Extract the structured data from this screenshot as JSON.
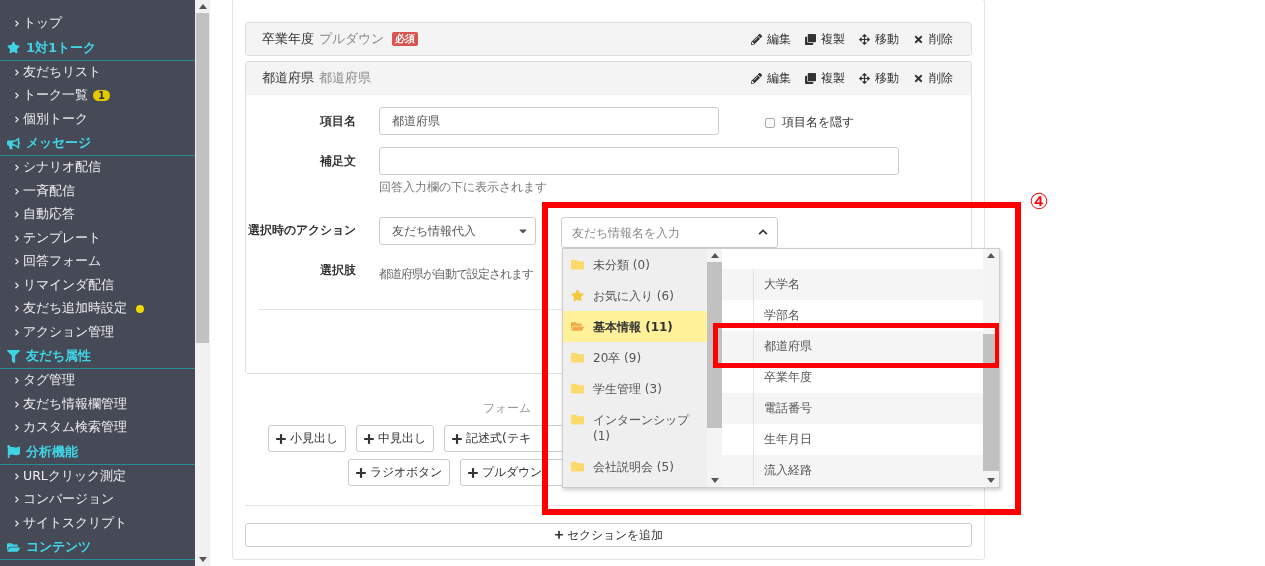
{
  "sidebar": {
    "items": [
      {
        "kind": "link",
        "label": "トップ",
        "dot": false
      },
      {
        "kind": "heading",
        "label": "1対1トーク"
      },
      {
        "kind": "link",
        "label": "友だちリスト",
        "dot": false
      },
      {
        "kind": "link",
        "label": "トーク一覧",
        "badge": "1",
        "dot": false
      },
      {
        "kind": "link",
        "label": "個別トーク",
        "dot": false
      },
      {
        "kind": "heading",
        "label": "メッセージ"
      },
      {
        "kind": "link",
        "label": "シナリオ配信",
        "dot": false
      },
      {
        "kind": "link",
        "label": "一斉配信",
        "dot": false
      },
      {
        "kind": "link",
        "label": "自動応答",
        "dot": false
      },
      {
        "kind": "link",
        "label": "テンプレート",
        "dot": false
      },
      {
        "kind": "link",
        "label": "回答フォーム",
        "dot": false
      },
      {
        "kind": "link",
        "label": "リマインダ配信",
        "dot": false
      },
      {
        "kind": "link",
        "label": "友だち追加時設定",
        "dot": true
      },
      {
        "kind": "link",
        "label": "アクション管理",
        "dot": false
      },
      {
        "kind": "heading",
        "label": "友だち属性"
      },
      {
        "kind": "link",
        "label": "タグ管理",
        "dot": false
      },
      {
        "kind": "link",
        "label": "友だち情報欄管理",
        "dot": false
      },
      {
        "kind": "link",
        "label": "カスタム検索管理",
        "dot": false
      },
      {
        "kind": "heading",
        "label": "分析機能"
      },
      {
        "kind": "link",
        "label": "URLクリック測定",
        "dot": false
      },
      {
        "kind": "link",
        "label": "コンバージョン",
        "dot": false
      },
      {
        "kind": "link",
        "label": "サイトスクリプト",
        "dot": false
      },
      {
        "kind": "heading",
        "label": "コンテンツ"
      }
    ]
  },
  "fields": [
    {
      "title": "卒業年度",
      "type": "プルダウン",
      "badge": "必須",
      "expanded": false,
      "actions": [
        "編集",
        "複製",
        "移動",
        "削除"
      ]
    },
    {
      "title": "都道府県",
      "type": "都道府県",
      "expanded": true,
      "actions": [
        "編集",
        "複製",
        "移動",
        "削除"
      ]
    }
  ],
  "editor": {
    "item_name": {
      "label": "項目名",
      "value": "都道府県"
    },
    "hide_name": {
      "label": "項目名を隠す",
      "checked": false
    },
    "note": {
      "label": "補足文",
      "hint": "回答入力欄の下に表示されます"
    },
    "action": {
      "label": "選択時のアクション",
      "select_value": "友だち情報代入",
      "search": {
        "placeholder": "友だち情報名を入力",
        "expanded": true
      }
    },
    "choices": {
      "label": "選択肢",
      "text": "都道府県が自動で設定されます"
    }
  },
  "dropdown": {
    "categories": [
      {
        "kind": "folder",
        "label": "未分類 (0)",
        "selected": false
      },
      {
        "kind": "favorite",
        "label": "お気に入り (6)",
        "selected": false
      },
      {
        "kind": "folder",
        "label": "基本情報 (11)",
        "selected": true
      },
      {
        "kind": "folder",
        "label": "20卒 (9)",
        "selected": false
      },
      {
        "kind": "folder",
        "label": "学生管理 (3)",
        "selected": false
      },
      {
        "kind": "folder",
        "label": "インターンシップ (1)",
        "selected": false
      },
      {
        "kind": "folder",
        "label": "会社説明会 (5)",
        "selected": false
      }
    ],
    "fields": [
      "大学名",
      "学部名",
      "都道府県",
      "卒業年度",
      "電話番号",
      "生年月日",
      "流入経路"
    ]
  },
  "add_fields": {
    "caption": "フォーム",
    "rows": [
      {
        "buttons": [
          "小見出し",
          "中見出し",
          "記述式(テキ"
        ]
      },
      {
        "buttons": [
          "ラジオボタン",
          "プルダウン"
        ]
      }
    ]
  },
  "add_section": "セクションを追加",
  "annotation": {
    "marker": "④"
  }
}
